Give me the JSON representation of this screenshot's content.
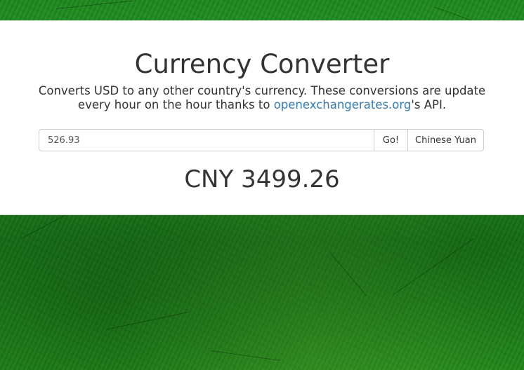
{
  "header": {
    "title": "Currency Converter"
  },
  "description": {
    "before_link": "Converts USD to any other country's currency. These conversions are update every hour on the hour thanks to ",
    "link_text": "openexchangerates.org",
    "after_link": "'s API."
  },
  "converter": {
    "amount_value": "526.93",
    "go_label": "Go!",
    "currency_label": "Chinese Yuan"
  },
  "result": {
    "text": "CNY 3499.26"
  },
  "colors": {
    "background": "#1f8a1f",
    "panel": "#ffffff",
    "link": "#337ab7",
    "text": "#333333"
  }
}
